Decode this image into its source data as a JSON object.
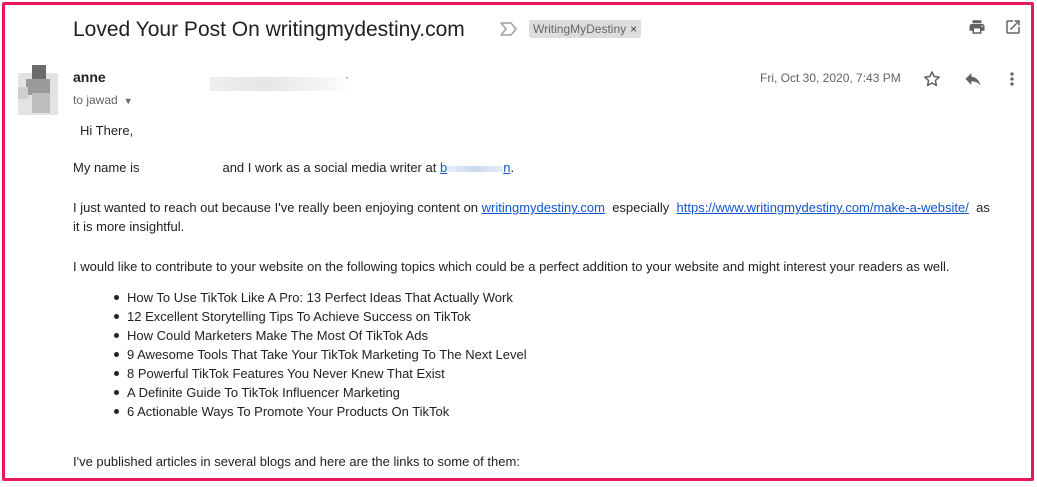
{
  "subject": "Loved Your Post On writingmydestiny.com",
  "label": {
    "text": "WritingMyDestiny",
    "remove": "×"
  },
  "toolbar": {
    "print_icon": "print-icon",
    "open_new_window_icon": "open-in-new-icon"
  },
  "message": {
    "sender_name": "anne",
    "sender_email_end": "·",
    "recipient": "to jawad",
    "date": "Fri, Oct 30, 2020, 7:43 PM",
    "actions": {
      "star_icon": "star-outline-icon",
      "reply_icon": "reply-icon",
      "more_icon": "more-vert-icon"
    }
  },
  "body": {
    "greeting": "Hi There,",
    "intro_part1": "My name is",
    "intro_part2": "and I work as a social media writer at",
    "intro_link_start": "b",
    "intro_link_end": "n",
    "intro_end": ".",
    "reach_part1": "I just wanted to reach out because I've really been enjoying content on",
    "reach_link1": "writingmydestiny.com",
    "reach_part2": "especially",
    "reach_link2": "https://www.writingmydestiny.com/make-a-website/",
    "reach_part3": "as",
    "reach_line2": "it is more insightful.",
    "contribute": "I would like to contribute to your website on the following topics which could be a perfect addition to your website and might interest your readers as well.",
    "topics": [
      "How To Use TikTok Like A Pro: 13 Perfect Ideas That Actually Work",
      "12 Excellent Storytelling Tips To Achieve Success on TikTok",
      "How Could Marketers Make The Most Of TikTok Ads",
      "9 Awesome Tools That Take Your TikTok Marketing To The Next Level",
      "8 Powerful TikTok Features You Never Knew That Exist",
      "A Definite Guide To TikTok Influencer Marketing",
      "6 Actionable Ways To Promote Your Products On TikTok"
    ],
    "published": "I've published articles in several blogs and here are the links to some of them:"
  },
  "colors": {
    "frame_border": "#e8185f",
    "link": "#1155cc",
    "label_bg": "#dddddd"
  }
}
